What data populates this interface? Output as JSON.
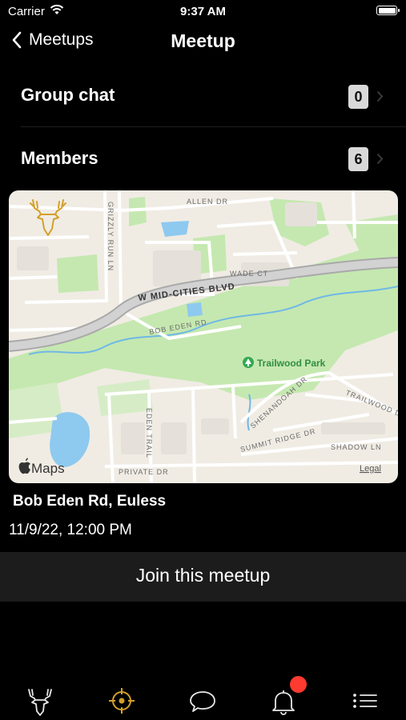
{
  "status_bar": {
    "carrier": "Carrier",
    "time": "9:37 AM"
  },
  "nav": {
    "back_label": "Meetups",
    "title": "Meetup"
  },
  "rows": [
    {
      "label": "Group chat",
      "count": "0"
    },
    {
      "label": "Members",
      "count": "6"
    }
  ],
  "map": {
    "streets": {
      "allen": "ALLEN DR",
      "grizzly": "GRIZZLY RUN LN",
      "wade": "WADE CT",
      "mid_cities": "W MID-CITIES BLVD",
      "bob_eden": "BOB EDEN RD",
      "trailwood_dr": "TRAILWOOD DR",
      "shenandoah": "SHENANDOAH DR",
      "eden_trail": "EDEN TRAIL",
      "summit_ridge": "SUMMIT RIDGE DR",
      "shadow": "SHADOW LN",
      "private": "PRIVATE DR"
    },
    "park": "Trailwood Park",
    "attribution": "Maps",
    "legal": "Legal"
  },
  "meetup": {
    "location": "Bob Eden Rd, Euless",
    "datetime": "11/9/22, 12:00 PM",
    "join_label": "Join this meetup"
  },
  "tabbar": {
    "tabs": [
      "deer-tab",
      "meetups-tab",
      "chat-tab",
      "notifications-tab",
      "menu-tab"
    ],
    "active": "meetups-tab",
    "accent": "#d4a02a"
  },
  "colors": {
    "background": "#000000",
    "badge": "#d9d9d9",
    "accent": "#d4a02a",
    "notification": "#ff3b30",
    "map_land": "#f0ece4",
    "map_park": "#c5e8b0",
    "map_water": "#8ec9ef"
  }
}
